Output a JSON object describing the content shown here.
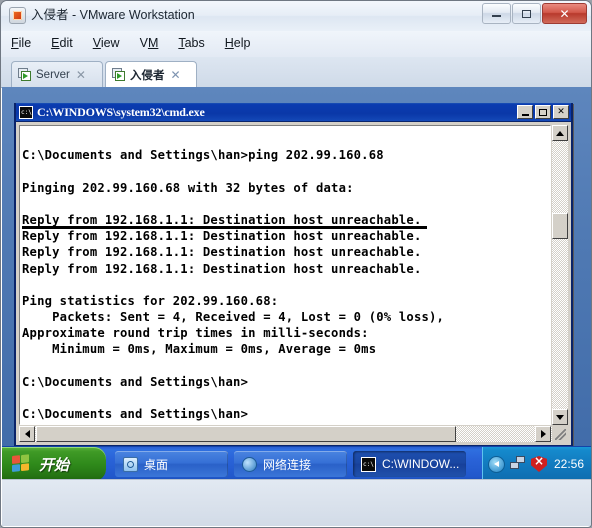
{
  "window": {
    "title": "入侵者 - VMware Workstation",
    "logo_icon": "vmware-logo-icon",
    "buttons": {
      "minimize": "minimize-icon",
      "maximize": "maximize-icon",
      "close": "✕"
    }
  },
  "menubar": {
    "items": [
      {
        "pre": "",
        "accel": "F",
        "post": "ile"
      },
      {
        "pre": "",
        "accel": "E",
        "post": "dit"
      },
      {
        "pre": "",
        "accel": "V",
        "post": "iew"
      },
      {
        "pre": "V",
        "accel": "M",
        "post": ""
      },
      {
        "pre": "",
        "accel": "T",
        "post": "abs"
      },
      {
        "pre": "",
        "accel": "H",
        "post": "elp"
      }
    ]
  },
  "tabs": [
    {
      "label": "Server",
      "active": false,
      "close": "✕"
    },
    {
      "label": "入侵者",
      "active": true,
      "close": "✕"
    }
  ],
  "guest": {
    "cmd_window": {
      "title": "C:\\WINDOWS\\system32\\cmd.exe",
      "icon": "cmd-console-icon",
      "buttons": {
        "minimize": "minimize-icon",
        "maximize": "maximize-icon",
        "close": "✕"
      },
      "lines": [
        "",
        "C:\\Documents and Settings\\han>ping 202.99.160.68",
        "",
        "Pinging 202.99.160.68 with 32 bytes of data:",
        "",
        "Reply from 192.168.1.1: Destination host unreachable.",
        "Reply from 192.168.1.1: Destination host unreachable.",
        "Reply from 192.168.1.1: Destination host unreachable.",
        "Reply from 192.168.1.1: Destination host unreachable.",
        "",
        "Ping statistics for 202.99.160.68:",
        "    Packets: Sent = 4, Received = 4, Lost = 0 (0% loss),",
        "Approximate round trip times in milli-seconds:",
        "    Minimum = 0ms, Maximum = 0ms, Average = 0ms",
        "",
        "C:\\Documents and Settings\\han>",
        "",
        "C:\\Documents and Settings\\han>"
      ],
      "scrollbar": {
        "up_arrow": "scroll-up-icon",
        "down_arrow": "scroll-down-icon",
        "left_arrow": "scroll-left-icon",
        "right_arrow": "scroll-right-icon"
      }
    },
    "background_window_title": "网络连接",
    "taskbar": {
      "start_label": "开始",
      "start_icon": "windows-flag-icon",
      "buttons": [
        {
          "label": "桌面",
          "icon": "desktop-icon",
          "active": false
        },
        {
          "label": "网络连接",
          "icon": "network-connections-icon",
          "active": false
        },
        {
          "label": "C:\\WINDOW...",
          "icon": "cmd-console-icon",
          "active": true
        }
      ],
      "tray": {
        "collapse_icon": "tray-collapse-arrow-icon",
        "network_icon": "network-status-icon",
        "security_icon": "security-alert-shield-icon",
        "clock": "22:56"
      }
    }
  }
}
